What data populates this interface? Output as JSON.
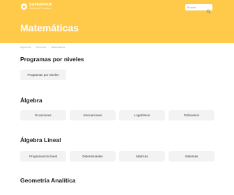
{
  "header": {
    "logo_name": "SUPERPROF",
    "logo_sub": "Superprof Recursos",
    "search_placeholder": "Buscar",
    "search_icon": "search-icon"
  },
  "page_title": "Matemáticas",
  "breadcrumb": [
    "Superprof",
    "Recursos",
    "Matemáticas"
  ],
  "sections": [
    {
      "title": "Programas por niveles",
      "items": [
        "Programas por niveles"
      ]
    },
    {
      "title": "Álgebra",
      "items": [
        "Ecuaciones",
        "Inecuaciones",
        "Logaritmos",
        "Polinomios"
      ]
    },
    {
      "title": "Álgebra Lineal",
      "items": [
        "Programación lineal",
        "Determinantes",
        "Matrices",
        "Sistemas"
      ]
    },
    {
      "title": "Geometría Analítica",
      "items": []
    }
  ],
  "colors": {
    "hero": "#ffc94a",
    "chip": "#f3f3f3"
  }
}
